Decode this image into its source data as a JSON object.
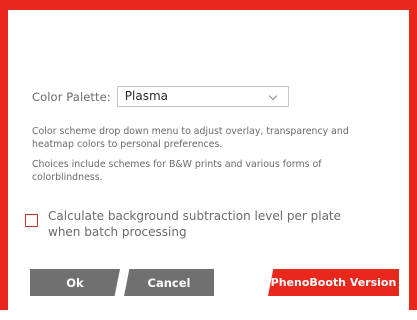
{
  "palette": {
    "label": "Color Palette:",
    "selected": "Plasma"
  },
  "description": {
    "line1": "Color scheme drop down menu to adjust overlay, transparency and heatmap colors to personal preferences.",
    "line2": "Choices include schemes for B&W prints and various forms of colorblindness."
  },
  "background_subtraction": {
    "label": "Calculate background subtraction level per plate when batch processing",
    "checked": false
  },
  "buttons": {
    "ok": "Ok",
    "cancel": "Cancel",
    "version": "PhenoBooth Version"
  },
  "colors": {
    "accent": "#e8271d",
    "button_gray": "#707070",
    "text_gray": "#6a6a6a"
  }
}
